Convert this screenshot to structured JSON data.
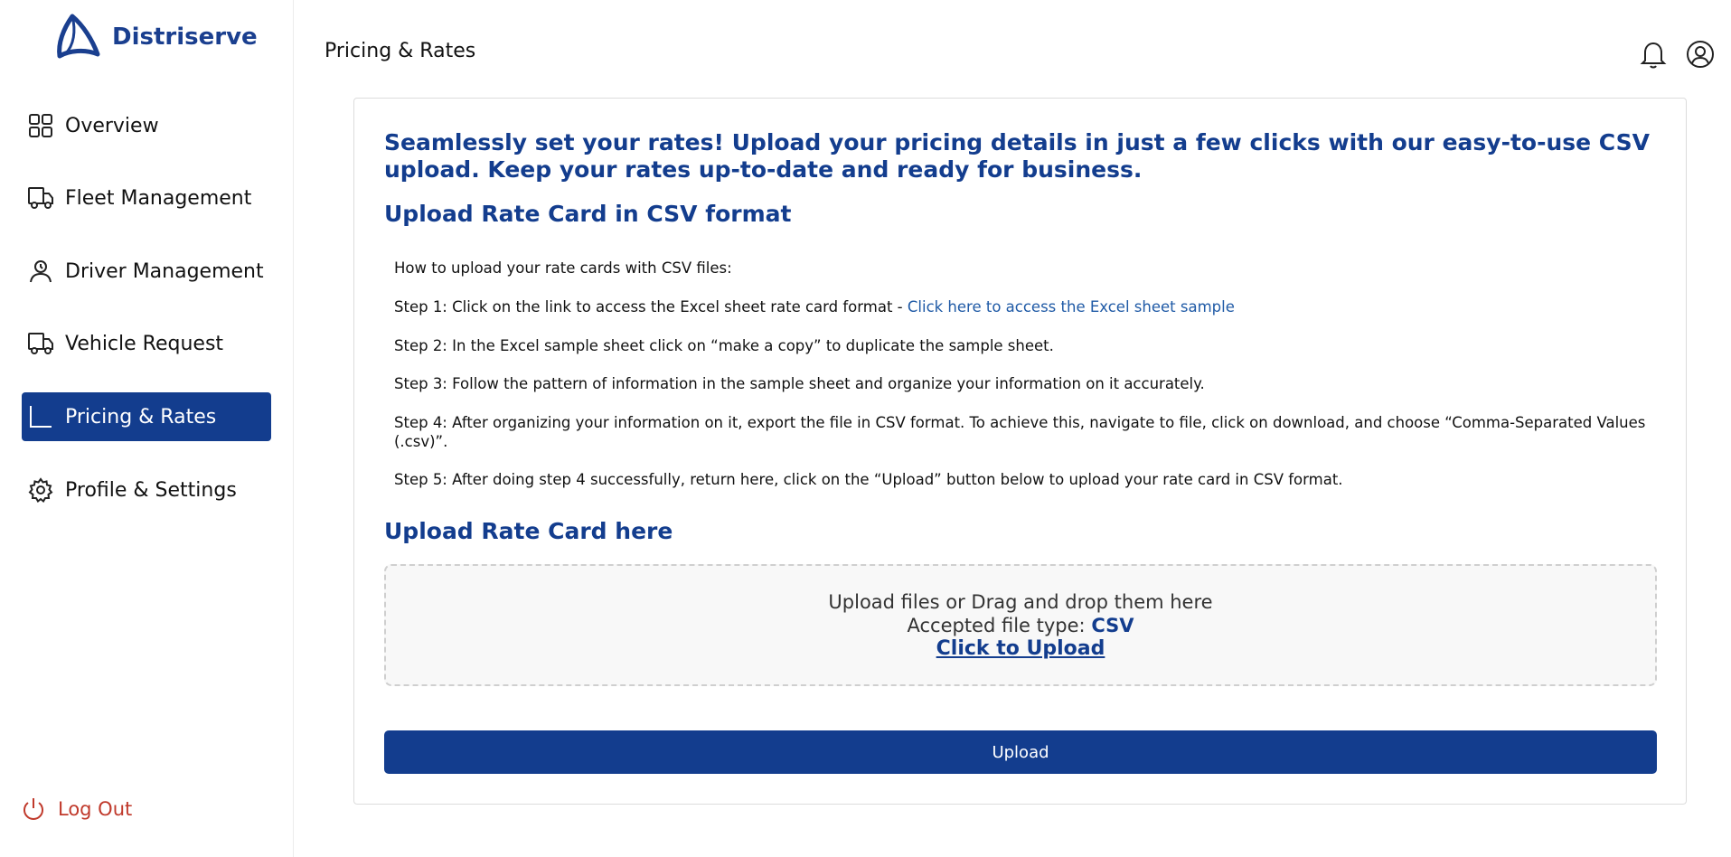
{
  "brand": {
    "name": "Distriserve",
    "color": "#1a3f8f"
  },
  "sidebar": {
    "items": [
      {
        "label": "Overview",
        "icon": "grid-icon"
      },
      {
        "label": "Fleet Management",
        "icon": "truck-icon"
      },
      {
        "label": "Driver Management",
        "icon": "user-icon"
      },
      {
        "label": "Vehicle Request",
        "icon": "truck-icon"
      },
      {
        "label": "Pricing & Rates",
        "icon": "corner-icon",
        "active": true
      },
      {
        "label": "Profile & Settings",
        "icon": "gear-icon"
      }
    ],
    "logout_label": "Log Out"
  },
  "header": {
    "title": "Pricing & Rates"
  },
  "main": {
    "headline": "Seamlessly set your rates! Upload your pricing details in just a few clicks with our easy-to-use CSV upload. Keep your rates up-to-date and ready for business.",
    "section1_title": "Upload Rate Card in CSV format",
    "intro": "How to upload your rate cards with CSV files:",
    "step1_prefix": "Step 1: Click on the link to access the Excel sheet rate card format - ",
    "step1_link": "Click here to access the Excel sheet sample",
    "step2": "Step 2: In the Excel sample sheet click on “make a copy” to duplicate the sample sheet.",
    "step3": "Step 3: Follow the pattern of information in the sample sheet and organize your information on it accurately.",
    "step4": "Step 4: After organizing your information on it, export the file in CSV format. To achieve this, navigate to file, click on download, and choose “Comma-Separated Values (.csv)”.",
    "step5": "Step 5: After doing step 4 successfully, return here, click on the “Upload” button below to upload your rate card in CSV format.",
    "section2_title": "Upload Rate Card here",
    "dropzone": {
      "line1": "Upload files or Drag and drop them here",
      "accepted_label": "Accepted file type: ",
      "accepted_type": "CSV",
      "click_label": "Click to Upload"
    },
    "upload_button": "Upload"
  },
  "colors": {
    "primary": "#133d8e",
    "logout": "#c0392b",
    "link": "#1f5aa6"
  }
}
